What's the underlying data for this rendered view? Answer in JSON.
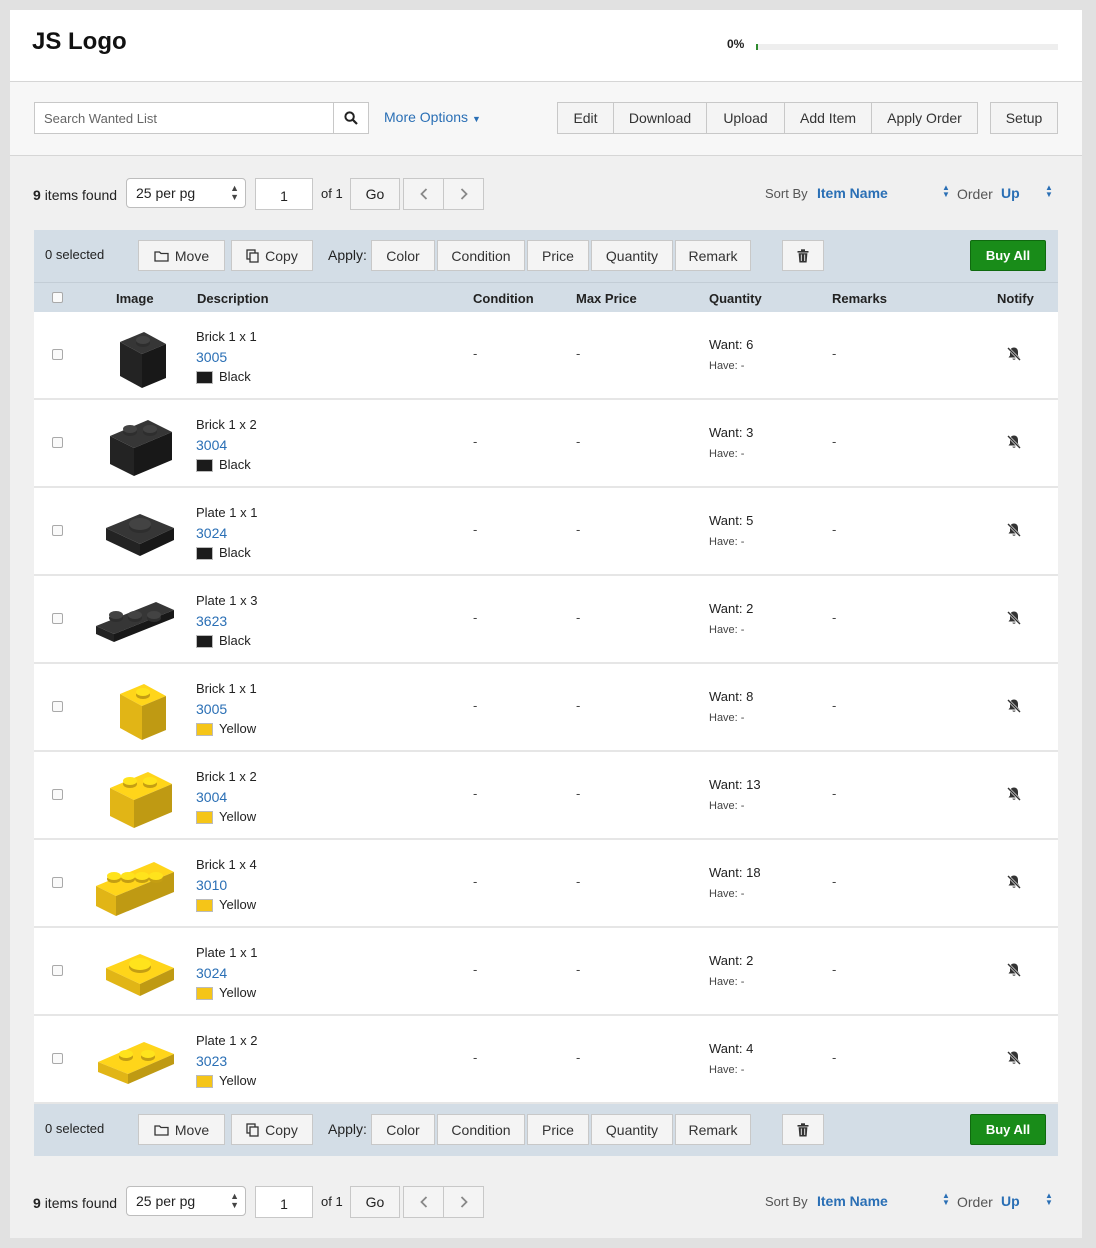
{
  "header": {
    "logo": "JS Logo",
    "progress_text": "0%",
    "progress_fraction": 0.0
  },
  "toolbar": {
    "search_placeholder": "Search Wanted List",
    "more_options": "More Options",
    "buttons": [
      "Edit",
      "Download",
      "Upload",
      "Add Item",
      "Apply Order"
    ],
    "setup": "Setup"
  },
  "pager": {
    "count": "9",
    "found_label": "items found",
    "per_page": "25 per pg",
    "page": "1",
    "of_total": "of 1",
    "go": "Go",
    "sort_label": "Sort By",
    "sort_value": "Item Name",
    "order_label": "Order",
    "order_value": "Up"
  },
  "actions": {
    "selected": "0 selected",
    "move": "Move",
    "copy": "Copy",
    "apply_label": "Apply:",
    "apply_buttons": [
      "Color",
      "Condition",
      "Price",
      "Quantity",
      "Remark"
    ],
    "buy_all": "Buy All"
  },
  "columns": {
    "image": "Image",
    "description": "Description",
    "condition": "Condition",
    "max_price": "Max Price",
    "quantity": "Quantity",
    "remarks": "Remarks",
    "notify": "Notify"
  },
  "items": [
    {
      "name": "Brick 1 x 1",
      "number": "3005",
      "color": "Black",
      "swatch": "#1b1b1b",
      "condition": "-",
      "max_price": "-",
      "want": "Want: 6",
      "have": "Have: -",
      "remarks": "-",
      "shape": "brick1x1"
    },
    {
      "name": "Brick 1 x 2",
      "number": "3004",
      "color": "Black",
      "swatch": "#1b1b1b",
      "condition": "-",
      "max_price": "-",
      "want": "Want: 3",
      "have": "Have: -",
      "remarks": "-",
      "shape": "brick1x2"
    },
    {
      "name": "Plate 1 x 1",
      "number": "3024",
      "color": "Black",
      "swatch": "#1b1b1b",
      "condition": "-",
      "max_price": "-",
      "want": "Want: 5",
      "have": "Have: -",
      "remarks": "-",
      "shape": "plate1x1"
    },
    {
      "name": "Plate 1 x 3",
      "number": "3623",
      "color": "Black",
      "swatch": "#1b1b1b",
      "condition": "-",
      "max_price": "-",
      "want": "Want: 2",
      "have": "Have: -",
      "remarks": "-",
      "shape": "plate1x3"
    },
    {
      "name": "Brick 1 x 1",
      "number": "3005",
      "color": "Yellow",
      "swatch": "#f5c518",
      "condition": "-",
      "max_price": "-",
      "want": "Want: 8",
      "have": "Have: -",
      "remarks": "-",
      "shape": "brick1x1"
    },
    {
      "name": "Brick 1 x 2",
      "number": "3004",
      "color": "Yellow",
      "swatch": "#f5c518",
      "condition": "-",
      "max_price": "-",
      "want": "Want: 13",
      "have": "Have: -",
      "remarks": "-",
      "shape": "brick1x2"
    },
    {
      "name": "Brick 1 x 4",
      "number": "3010",
      "color": "Yellow",
      "swatch": "#f5c518",
      "condition": "-",
      "max_price": "-",
      "want": "Want: 18",
      "have": "Have: -",
      "remarks": "-",
      "shape": "brick1x4"
    },
    {
      "name": "Plate 1 x 1",
      "number": "3024",
      "color": "Yellow",
      "swatch": "#f5c518",
      "condition": "-",
      "max_price": "-",
      "want": "Want: 2",
      "have": "Have: -",
      "remarks": "-",
      "shape": "plate1x1"
    },
    {
      "name": "Plate 1 x 2",
      "number": "3023",
      "color": "Yellow",
      "swatch": "#f5c518",
      "condition": "-",
      "max_price": "-",
      "want": "Want: 4",
      "have": "Have: -",
      "remarks": "-",
      "shape": "plate1x2"
    }
  ],
  "icons": {
    "search": "search-icon",
    "more_caret": "caret-down-icon",
    "move": "folder-icon",
    "copy": "copy-icon",
    "delete": "trash-icon",
    "notify": "bell-off-icon",
    "prev": "chevron-left-icon",
    "next": "chevron-right-icon"
  },
  "colors": {
    "link": "#2a6fb5",
    "buy_all": "#198c19",
    "action_bar": "#d3dde6"
  }
}
